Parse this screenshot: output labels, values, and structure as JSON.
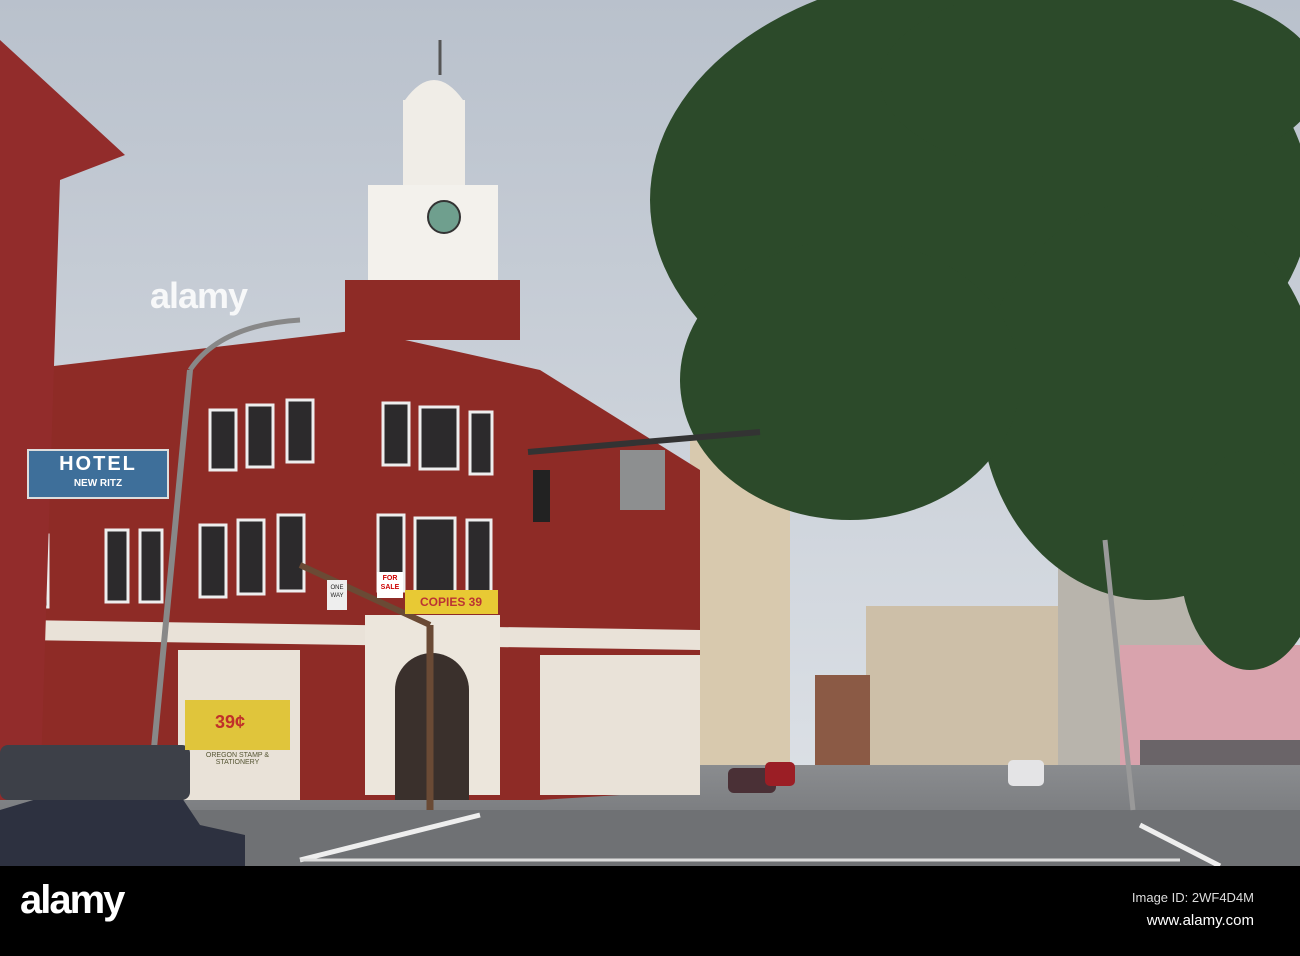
{
  "photo": {
    "hotel_sign": {
      "title": "HOTEL",
      "subtitle": "NEW RITZ"
    },
    "for_sale_sign": "FOR SALE",
    "one_way_sign": "ONE WAY",
    "copies_banner": "COPIES 39",
    "window_price": "39¢",
    "store_name": "OREGON STAMP & STATIONERY"
  },
  "watermark": {
    "logo": "alamy",
    "image_id": "Image ID: 2WF4D4M",
    "url": "www.alamy.com"
  },
  "colors": {
    "brick": "#8e2b26",
    "sky": "#cfd5dd",
    "tree": "#2c4a2a",
    "road": "#7b7d80"
  }
}
